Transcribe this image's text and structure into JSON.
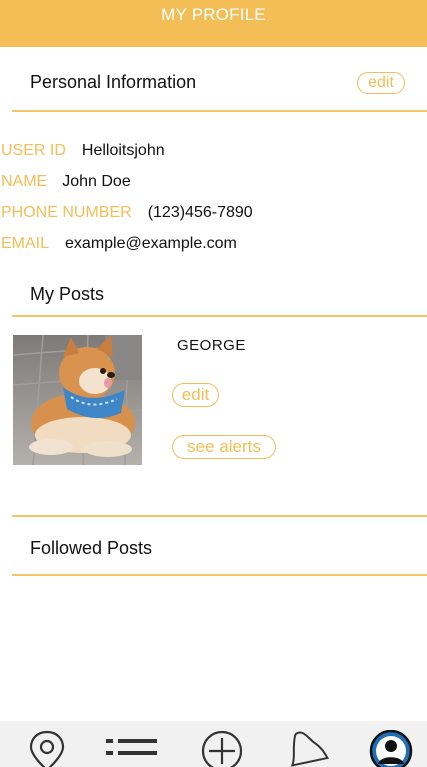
{
  "header": {
    "title": "MY PROFILE"
  },
  "personal": {
    "title": "Personal Information",
    "edit_label": "edit",
    "fields": [
      {
        "label": "USER ID",
        "value": "Helloitsjohn"
      },
      {
        "label": "NAME",
        "value": "John Doe"
      },
      {
        "label": "PHONE NUMBER",
        "value": "(123)456-7890"
      },
      {
        "label": "EMAIL",
        "value": "example@example.com"
      }
    ]
  },
  "my_posts": {
    "title": "My Posts",
    "items": [
      {
        "name": "GEORGE",
        "edit_label": "edit",
        "alerts_label": "see alerts"
      }
    ]
  },
  "followed_posts": {
    "title": "Followed Posts"
  },
  "tabbar": {
    "items": [
      {
        "icon": "location-pin-icon"
      },
      {
        "icon": "list-icon"
      },
      {
        "icon": "add-circle-icon"
      },
      {
        "icon": "bell-icon"
      },
      {
        "icon": "profile-icon",
        "active": true
      }
    ]
  },
  "colors": {
    "accent": "#F2BE55",
    "header_bg": "#F2BE55",
    "profile_active": "#1E6FB8"
  }
}
